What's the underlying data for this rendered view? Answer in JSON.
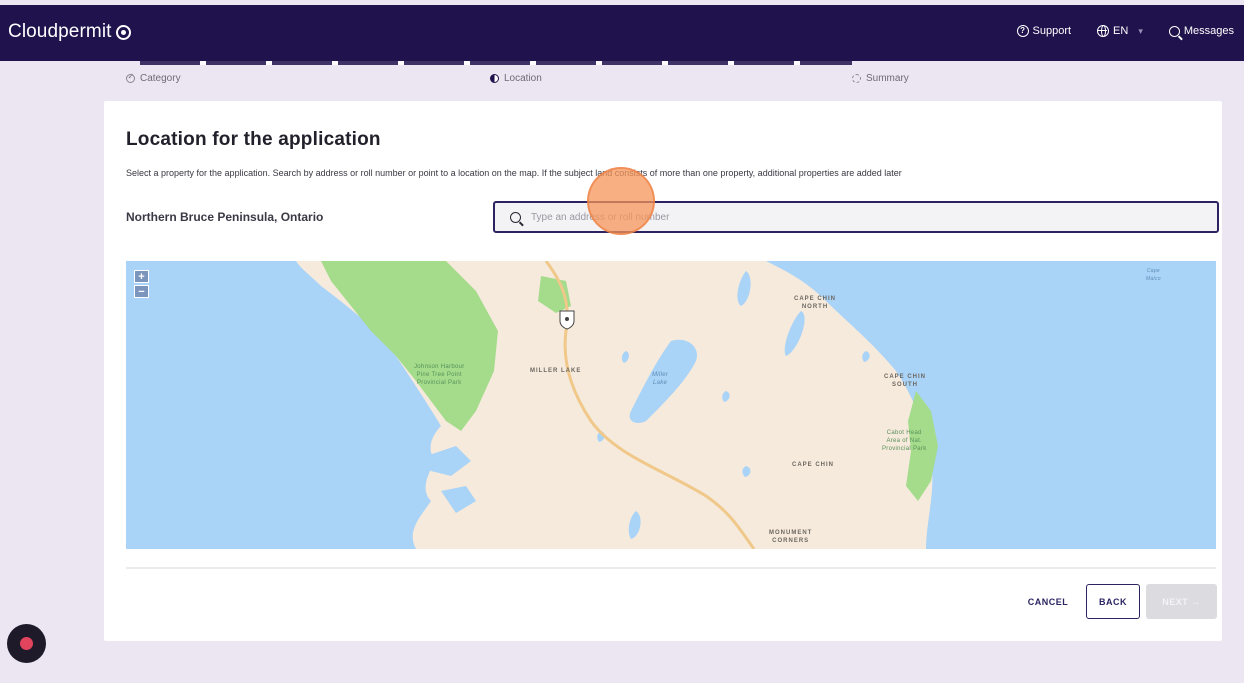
{
  "header": {
    "brand": "Cloudpermit",
    "support_label": "Support",
    "language_label": "EN",
    "messages_label": "Messages"
  },
  "steps": [
    {
      "label": "Category",
      "state": "done"
    },
    {
      "label": "Location",
      "state": "current"
    },
    {
      "label": "Summary",
      "state": "pending"
    }
  ],
  "page": {
    "title": "Location for the application",
    "subtitle": "Select a property for the application. Search by address or roll number or point to a location on the map. If the subject land consists of more than one property, additional properties are added later",
    "municipality": "Northern Bruce Peninsula, Ontario"
  },
  "search": {
    "placeholder": "Type an address or roll number",
    "value": ""
  },
  "map": {
    "zoom_in": "+",
    "zoom_out": "−",
    "labels": {
      "cape_chin_north": "CAPE CHIN\nNORTH",
      "miller_lake": "MILLER LAKE",
      "miller_lake_water": "Miller\nLake",
      "cape_chin_south": "CAPE CHIN\nSOUTH",
      "cape_chin": "CAPE CHIN",
      "monument_corners": "MONUMENT\nCORNERS",
      "park_west": "Johnson Harbour\nPine Tree Point\nProvincial Park",
      "park_east": "Cabot Head\nArea of Nat.\nProvincial Park",
      "corner_label": "Cape\nMalco"
    },
    "colors": {
      "water": "#a9d3f7",
      "land": "#f6eadc",
      "park": "#a4dc8c",
      "road": "#f0c88a"
    }
  },
  "actions": {
    "cancel": "CANCEL",
    "back": "BACK",
    "next": "NEXT →"
  },
  "colors": {
    "brand": "#20124d",
    "page_background": "#ebe6f1",
    "highlight": "#f5965a"
  }
}
